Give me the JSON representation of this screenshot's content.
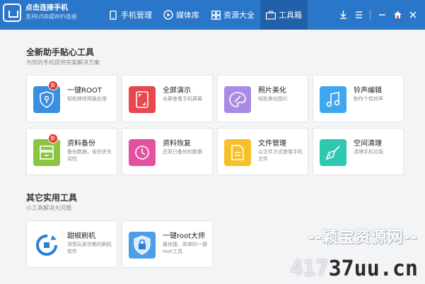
{
  "app": {
    "title": "点击连接手机",
    "subtitle": "支持USB或WiFi连接"
  },
  "nav": [
    {
      "label": "手机管理",
      "icon": "phone-icon",
      "active": false
    },
    {
      "label": "媒体库",
      "icon": "play-icon",
      "active": false
    },
    {
      "label": "资源大全",
      "icon": "grid-icon",
      "active": false
    },
    {
      "label": "工具箱",
      "icon": "toolbox-icon",
      "active": true
    }
  ],
  "window_controls": [
    "download-icon",
    "menu-icon",
    "minimize-icon",
    "home-icon",
    "close-icon"
  ],
  "section1": {
    "title": "全新助手贴心工具",
    "subtitle": "为您的手机提供完美解决方案"
  },
  "tools": [
    {
      "title": "一键ROOT",
      "desc": "轻松移除预装应用",
      "icon": "shield-key-icon",
      "color": "#3b8fe0",
      "badge": "新"
    },
    {
      "title": "全屏演示",
      "desc": "全屏查看手机屏幕",
      "icon": "fullscreen-icon",
      "color": "#e8474f"
    },
    {
      "title": "照片美化",
      "desc": "轻松美化图片",
      "icon": "palette-icon",
      "color": "#a98be6"
    },
    {
      "title": "铃声编辑",
      "desc": "制作个性铃声",
      "icon": "music-note-icon",
      "color": "#3ea8ef"
    },
    {
      "title": "资料备份",
      "desc": "备份数据，告别丢失风险",
      "icon": "backup-icon",
      "color": "#8bc53f",
      "badge": "新"
    },
    {
      "title": "资料恢复",
      "desc": "还原已备份的数据",
      "icon": "clock-restore-icon",
      "color": "#e5509f"
    },
    {
      "title": "文件管理",
      "desc": "以文件方式查看手机文件",
      "icon": "folder-icon",
      "color": "#f5c02a"
    },
    {
      "title": "空间清理",
      "desc": "清理手机垃圾",
      "icon": "broom-icon",
      "color": "#2ec7b0"
    }
  ],
  "section2": {
    "title": "其它实用工具",
    "subtitle": "小工具解决大问题"
  },
  "other_tools": [
    {
      "title": "甜椒刷机",
      "desc": "深受玩家信赖的刷机软件",
      "icon": "refresh-logo-icon",
      "color": "#2a7fd6"
    },
    {
      "title": "一键root大师",
      "desc": "最快捷、简单的一键root工具",
      "icon": "shield-lock-icon",
      "color": "#4a9fe8"
    }
  ],
  "watermark": {
    "top": "--颖宝资源网--",
    "bottom_prefix": "417",
    "bottom_main": "37uu.cn"
  }
}
